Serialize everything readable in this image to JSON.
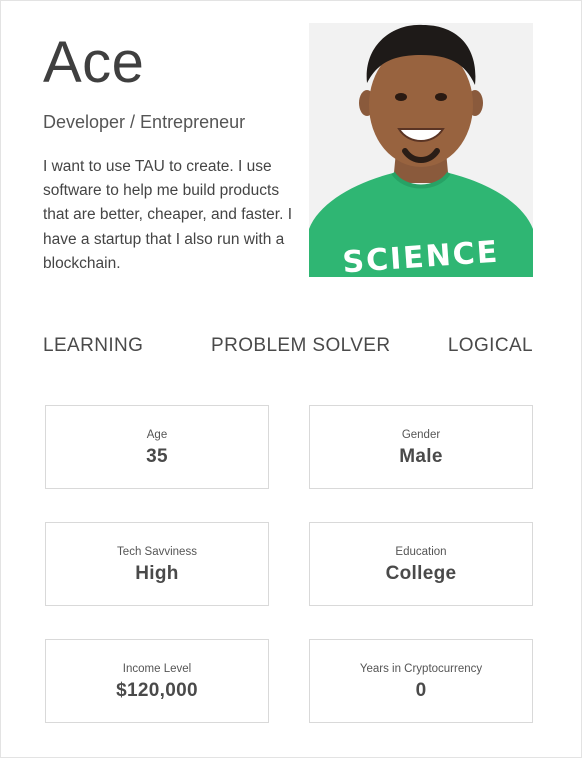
{
  "persona": {
    "name": "Ace",
    "role": "Developer / Entrepreneur",
    "bio": "I want to use TAU to create. I use software to help me build products that are better, cheaper, and faster. I have a startup that I also run with a blockchain.",
    "photo": {
      "shirt_text": "SCIENCE",
      "shirt_color": "#2fb673"
    }
  },
  "traits": [
    "LEARNING",
    "PROBLEM SOLVER",
    "LOGICAL"
  ],
  "stats": [
    {
      "label": "Age",
      "value": "35"
    },
    {
      "label": "Gender",
      "value": "Male"
    },
    {
      "label": "Tech Savviness",
      "value": "High"
    },
    {
      "label": "Education",
      "value": "College"
    },
    {
      "label": "Income Level",
      "value": "$120,000"
    },
    {
      "label": "Years in Cryptocurrency",
      "value": "0"
    }
  ]
}
